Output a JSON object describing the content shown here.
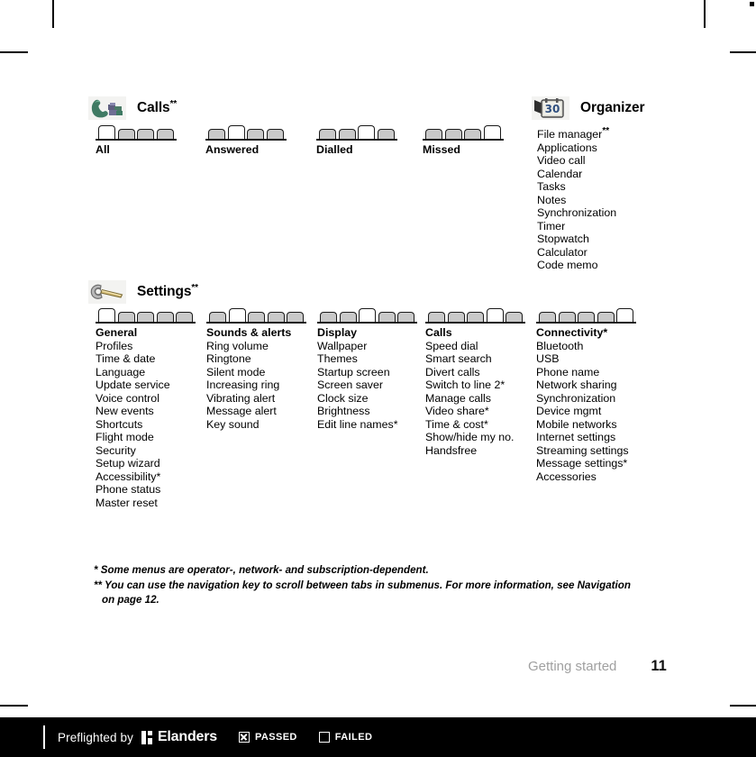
{
  "page": {
    "chapter": "Getting started",
    "number": "11"
  },
  "sections": [
    {
      "id": "calls",
      "icon": "phone-handset-icon",
      "title": "Calls",
      "title_sup": "**",
      "tab_count": 4,
      "columns": [
        {
          "header": "All",
          "header_sup": "",
          "selected_tab": 1,
          "items": []
        },
        {
          "header": "Answered",
          "header_sup": "",
          "selected_tab": 2,
          "items": []
        },
        {
          "header": "Dialled",
          "header_sup": "",
          "selected_tab": 3,
          "items": []
        },
        {
          "header": "Missed",
          "header_sup": "",
          "selected_tab": 4,
          "items": []
        }
      ]
    },
    {
      "id": "organizer",
      "icon": "calendar-organizer-icon",
      "title": "Organizer",
      "title_sup": "",
      "tab_count": 0,
      "columns": [
        {
          "header": "File manager",
          "header_sup": "**",
          "selected_tab": 0,
          "items": [
            "Applications",
            "Video call",
            "Calendar",
            "Tasks",
            "Notes",
            "Synchronization",
            "Timer",
            "Stopwatch",
            "Calculator",
            "Code memo"
          ]
        }
      ]
    },
    {
      "id": "settings",
      "icon": "wrench-icon",
      "title": "Settings",
      "title_sup": "**",
      "tab_count": 5,
      "columns": [
        {
          "header": "General",
          "header_sup": "",
          "selected_tab": 1,
          "items": [
            "Profiles",
            "Time & date",
            "Language",
            "Update service",
            "Voice control",
            "New events",
            "Shortcuts",
            "Flight mode",
            "Security",
            "Setup wizard",
            "Accessibility*",
            "Phone status",
            "Master reset"
          ]
        },
        {
          "header": "Sounds & alerts",
          "header_sup": "",
          "selected_tab": 2,
          "items": [
            "Ring volume",
            "Ringtone",
            "Silent mode",
            "Increasing ring",
            "Vibrating alert",
            "Message alert",
            "Key sound"
          ]
        },
        {
          "header": "Display",
          "header_sup": "",
          "selected_tab": 3,
          "items": [
            "Wallpaper",
            "Themes",
            "Startup screen",
            "Screen saver",
            "Clock size",
            "Brightness",
            "Edit line names*"
          ]
        },
        {
          "header": "Calls",
          "header_sup": "",
          "selected_tab": 4,
          "items": [
            "Speed dial",
            "Smart search",
            "Divert calls",
            "Switch to line 2*",
            "Manage calls",
            "Video share*",
            "Time & cost*",
            "Show/hide my no.",
            "Handsfree"
          ]
        },
        {
          "header": "Connectivity*",
          "header_sup": "",
          "selected_tab": 5,
          "items": [
            "Bluetooth",
            "USB",
            "Phone name",
            "Network sharing",
            "Synchronization",
            "Device mgmt",
            "Mobile networks",
            "Internet settings",
            "Streaming settings",
            "Message settings*",
            "Accessories"
          ]
        }
      ]
    }
  ],
  "footnotes": [
    "* Some menus are operator-, network- and subscription-dependent.",
    "** You can use the navigation key to scroll between tabs in submenus. For more information, see Navigation",
    "on page 12."
  ],
  "preflight": {
    "text": "Preflighted by",
    "brand": "Elanders",
    "passed_label": "PASSED",
    "failed_label": "FAILED",
    "passed_checked": true,
    "failed_checked": false
  },
  "colors": {
    "tab_fill": "#c9c9c9",
    "tab_stroke": "#1a1a1a",
    "chapter_gray": "#a0a0a0",
    "preflight_bg": "#000000"
  }
}
